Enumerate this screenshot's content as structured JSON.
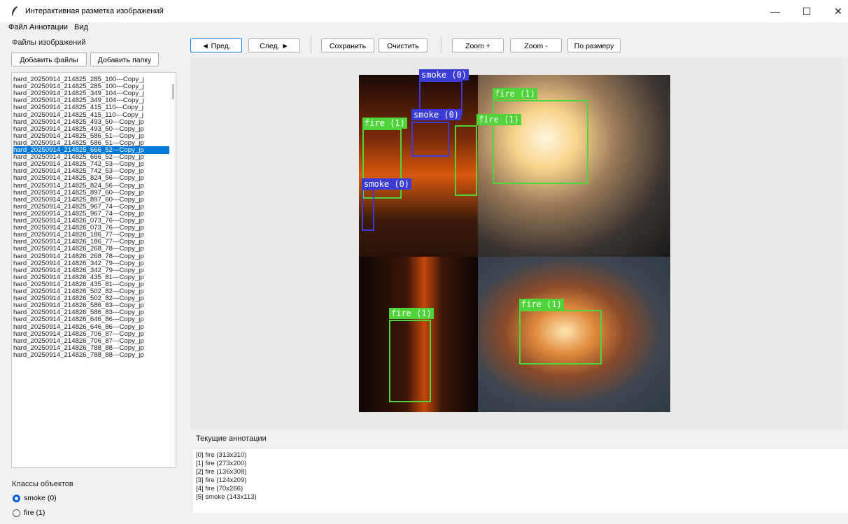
{
  "window": {
    "title": "Интерактивная разметка изображений",
    "minimize": "—",
    "maximize": "☐",
    "close": "✕"
  },
  "menu": [
    "Файл",
    "Аннотации",
    "Вид"
  ],
  "left": {
    "files_group_title": "Файлы изображений",
    "add_files": "Добавить файлы",
    "add_folder": "Добавить папку",
    "files": [
      "hard_20250914_214825_285_100---Copy_j",
      "hard_20250914_214825_285_100---Copy_j",
      "hard_20250914_214825_349_104---Copy_j",
      "hard_20250914_214825_349_104---Copy_j",
      "hard_20250914_214825_415_110---Copy_j",
      "hard_20250914_214825_415_110---Copy_j",
      "hard_20250914_214825_493_50---Copy_jp",
      "hard_20250914_214825_493_50---Copy_jp",
      "hard_20250914_214825_586_51---Copy_jp",
      "hard_20250914_214825_586_51---Copy_jp",
      "hard_20250914_214825_666_52---Copy_jp",
      "hard_20250914_214825_666_52---Copy_jp",
      "hard_20250914_214825_742_53---Copy_jp",
      "hard_20250914_214825_742_53---Copy_jp",
      "hard_20250914_214825_824_56---Copy_jp",
      "hard_20250914_214825_824_56---Copy_jp",
      "hard_20250914_214825_897_60---Copy_jp",
      "hard_20250914_214825_897_60---Copy_jp",
      "hard_20250914_214825_967_74---Copy_jp",
      "hard_20250914_214825_967_74---Copy_jp",
      "hard_20250914_214826_073_76---Copy_jp",
      "hard_20250914_214826_073_76---Copy_jp",
      "hard_20250914_214826_186_77---Copy_jp",
      "hard_20250914_214826_186_77---Copy_jp",
      "hard_20250914_214826_268_78---Copy_jp",
      "hard_20250914_214826_268_78---Copy_jp",
      "hard_20250914_214826_342_79---Copy_jp",
      "hard_20250914_214826_342_79---Copy_jp",
      "hard_20250914_214826_435_81---Copy_jp",
      "hard_20250914_214826_435_81---Copy_jp",
      "hard_20250914_214826_502_82---Copy_jp",
      "hard_20250914_214826_502_82---Copy_jp",
      "hard_20250914_214826_586_83---Copy_jp",
      "hard_20250914_214826_586_83---Copy_jp",
      "hard_20250914_214826_646_86---Copy_jp",
      "hard_20250914_214826_646_86---Copy_jp",
      "hard_20250914_214826_706_87---Copy_jp",
      "hard_20250914_214826_706_87---Copy_jp",
      "hard_20250914_214826_788_88---Copy_jp",
      "hard_20250914_214826_788_88---Copy_jp"
    ],
    "selected_index": 10,
    "classes_group_title": "Классы объектов",
    "classes": [
      {
        "label": "smoke (0)",
        "selected": true
      },
      {
        "label": "fire (1)",
        "selected": false
      }
    ]
  },
  "toolbar": {
    "prev": "◄ Пред.",
    "next": "След. ►",
    "save": "Сохранить",
    "clear": "Очистить",
    "zoom_in": "Zoom +",
    "zoom_out": "Zoom -",
    "fit": "По размеру"
  },
  "image_boxes": [
    {
      "label": "smoke (0)",
      "cls": "smoke"
    },
    {
      "label": "smoke (0)",
      "cls": "smoke"
    },
    {
      "label": "fire (1)",
      "cls": "fire"
    },
    {
      "label": "fire (1)",
      "cls": "fire"
    },
    {
      "label": "fire (1)",
      "cls": "fire"
    },
    {
      "label": "smoke (0)",
      "cls": "smoke"
    },
    {
      "label": "fire (1)",
      "cls": "fire"
    },
    {
      "label": "fire (1)",
      "cls": "fire"
    }
  ],
  "colors": {
    "smoke": "#3b3bd6",
    "fire": "#4fd43a",
    "selection": "#0078d7"
  },
  "annotations": {
    "title": "Текущие аннотации",
    "items": [
      "[0] fire (313x310)",
      "[1] fire (273x200)",
      "[2] fire (136x308)",
      "[3] fire (124x209)",
      "[4] fire (70x266)",
      "[5] smoke (143x113)"
    ]
  }
}
